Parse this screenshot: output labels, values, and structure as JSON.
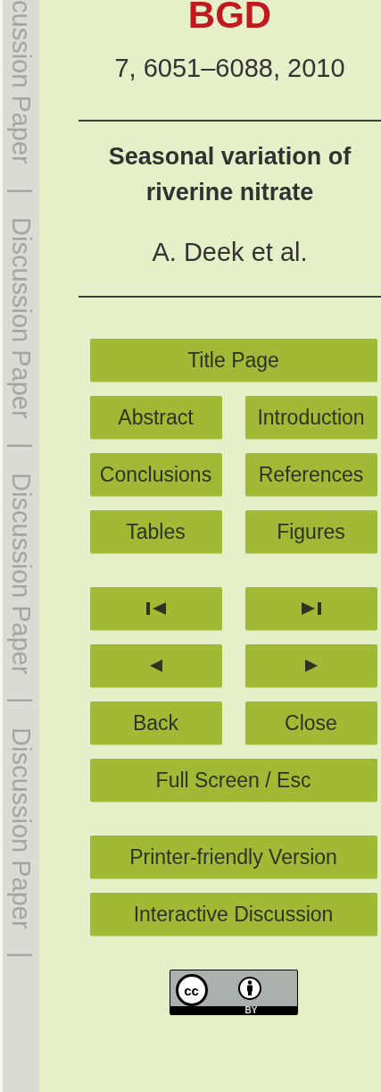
{
  "margin_label": [
    "cussion Paper",
    "|",
    "Discussion Paper",
    "|",
    "Discussion Paper",
    "|",
    "Discussion Paper",
    "|"
  ],
  "header": {
    "journal": "BGD",
    "citation": "7, 6051–6088, 2010",
    "title": "Seasonal variation of riverine nitrate",
    "authors": "A. Deek et al."
  },
  "button_groups": [
    [
      [
        {
          "kind": "text",
          "label": "Title Page"
        }
      ],
      [
        {
          "kind": "text",
          "label": "Abstract"
        },
        {
          "kind": "text",
          "label": "Introduction"
        }
      ],
      [
        {
          "kind": "text",
          "label": "Conclusions"
        },
        {
          "kind": "text",
          "label": "References"
        }
      ],
      [
        {
          "kind": "text",
          "label": "Tables"
        },
        {
          "kind": "text",
          "label": "Figures"
        }
      ]
    ],
    [
      [
        {
          "kind": "first"
        },
        {
          "kind": "last"
        }
      ],
      [
        {
          "kind": "previous"
        },
        {
          "kind": "next"
        }
      ],
      [
        {
          "kind": "text",
          "label": "Back"
        },
        {
          "kind": "text",
          "label": "Close"
        }
      ],
      [
        {
          "kind": "text",
          "label": "Full Screen / Esc"
        }
      ]
    ],
    [
      [
        {
          "kind": "text",
          "label": "Printer-friendly Version"
        }
      ],
      [
        {
          "kind": "text",
          "label": "Interactive Discussion"
        }
      ]
    ]
  ],
  "license": {
    "mark": "cc",
    "label": "BY"
  }
}
